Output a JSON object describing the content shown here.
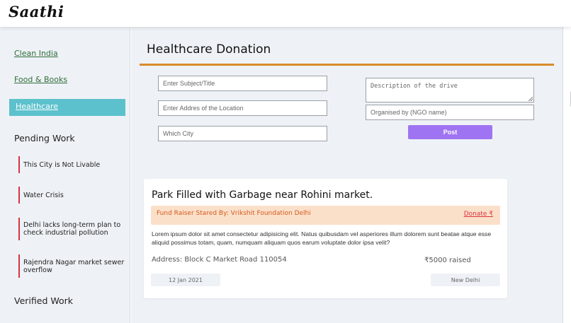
{
  "header": {
    "logo": "Saathi"
  },
  "sidebar": {
    "links": [
      {
        "label": "Clean India"
      },
      {
        "label": "Food & Books"
      },
      {
        "label": "Healthcare",
        "active": true
      }
    ],
    "pending_heading": "Pending Work",
    "pending_items": [
      {
        "label": "This City is Not Livable"
      },
      {
        "label": "Water Crisis"
      },
      {
        "label": "Delhi lacks long-term plan to check industrial pollution"
      },
      {
        "label": "Rajendra Nagar market sewer overflow"
      }
    ],
    "verified_heading": "Verified Work"
  },
  "main": {
    "title": "Healthcare Donation",
    "form": {
      "subject_placeholder": "Enter Subject/Title",
      "location_placeholder": "Enter Addres of the Location",
      "city_placeholder": "Which City",
      "description_placeholder": "Description of the drive",
      "organiser_placeholder": "Organised by (NGO name)",
      "post_label": "Post"
    },
    "card": {
      "title": "Park Filled with Garbage near Rohini market.",
      "fund_raiser": "Fund Raiser Stared By: Vrikshit Foundation Delhi",
      "donate_label": "Donate ₹",
      "description": "Lorem ipsum dolor sit amet consectetur adipisicing elit. Natus quibusdam vel asperiores illum dolorem sunt beatae atque esse aliquid possimus totam, quam, numquam aliquam quos earum voluptate dolor ipsa velit?",
      "address": "Address: Block C Market Road 110054",
      "raised": "₹5000 raised",
      "date": "12 Jan 2021",
      "city": "New Delhi"
    }
  },
  "colors": {
    "accent_rule": "#d98b2b",
    "active_sidebar": "#5cc1cc",
    "post_button": "#9f74f2",
    "pending_marker": "#d9323f",
    "fund_bar": "#fbe0c9"
  }
}
